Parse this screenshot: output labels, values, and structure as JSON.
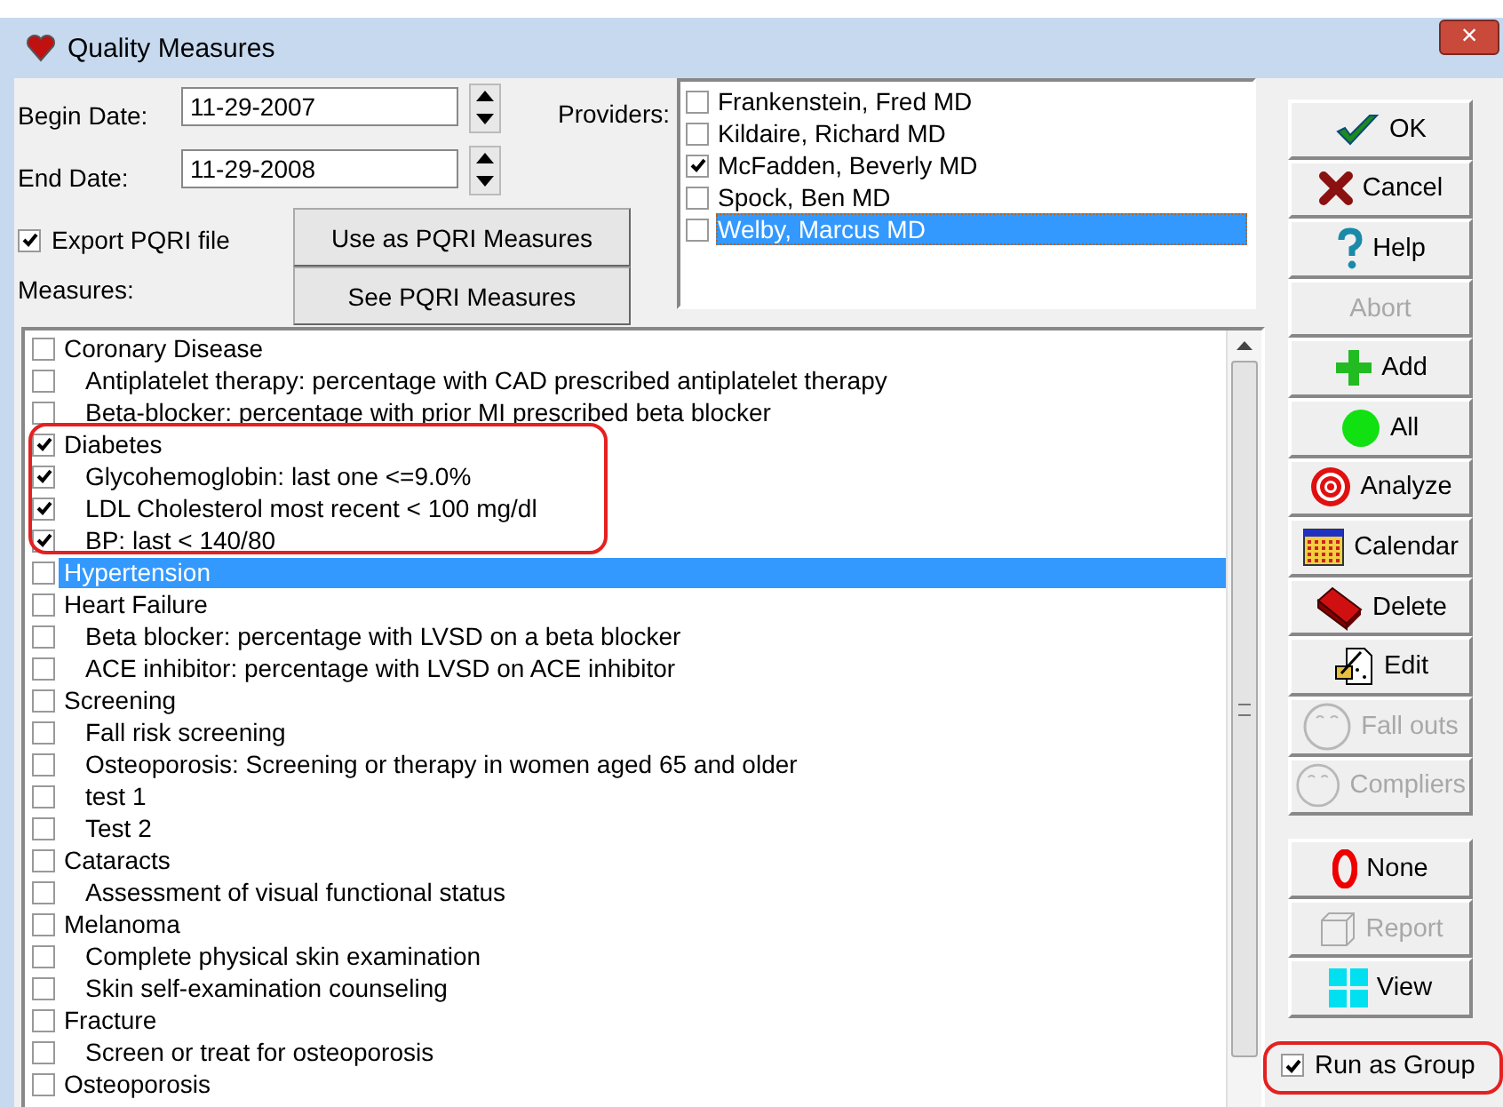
{
  "window": {
    "title": "Quality Measures",
    "close": "×"
  },
  "form": {
    "begin_label": "Begin Date:",
    "begin_value": "11-29-2007",
    "end_label": "End Date:",
    "end_value": "11-29-2008",
    "providers_label": "Providers:",
    "export_label": "Export PQRI file",
    "export_checked": true,
    "measures_label": "Measures:",
    "use_button": "Use as PQRI  Measures",
    "see_button": "See PQRI Measures"
  },
  "providers": [
    {
      "name": "Frankenstein, Fred MD",
      "checked": false,
      "selected": false
    },
    {
      "name": "Kildaire, Richard MD",
      "checked": false,
      "selected": false
    },
    {
      "name": "McFadden, Beverly MD",
      "checked": true,
      "selected": false
    },
    {
      "name": "Spock, Ben MD",
      "checked": false,
      "selected": false
    },
    {
      "name": "Welby, Marcus MD",
      "checked": false,
      "selected": true
    }
  ],
  "measures": [
    {
      "label": "Coronary Disease",
      "checked": false,
      "selected": false,
      "children": [
        {
          "label": "Antiplatelet therapy: percentage with CAD prescribed antiplatelet therapy",
          "checked": false,
          "selected": false
        },
        {
          "label": "Beta-blocker: percentage with prior MI prescribed beta blocker",
          "checked": false,
          "selected": false
        }
      ]
    },
    {
      "label": "Diabetes",
      "checked": true,
      "selected": false,
      "children": [
        {
          "label": "Glycohemoglobin: last one <=9.0%",
          "checked": true,
          "selected": false
        },
        {
          "label": "LDL Cholesterol most recent < 100 mg/dl",
          "checked": true,
          "selected": false
        },
        {
          "label": "BP: last < 140/80",
          "checked": true,
          "selected": false
        }
      ]
    },
    {
      "label": "Hypertension",
      "checked": false,
      "selected": true
    },
    {
      "label": "Heart Failure",
      "checked": false,
      "selected": false,
      "children": [
        {
          "label": "Beta blocker: percentage with LVSD on a beta blocker",
          "checked": false,
          "selected": false
        },
        {
          "label": "ACE inhibitor: percentage with LVSD on ACE inhibitor",
          "checked": false,
          "selected": false
        }
      ]
    },
    {
      "label": "Screening",
      "checked": false,
      "selected": false,
      "children": [
        {
          "label": "Fall risk screening",
          "checked": false,
          "selected": false
        },
        {
          "label": "Osteoporosis: Screening or therapy in women aged 65 and older",
          "checked": false,
          "selected": false
        },
        {
          "label": "test 1",
          "checked": false,
          "selected": false
        },
        {
          "label": "Test 2",
          "checked": false,
          "selected": false
        }
      ]
    },
    {
      "label": "Cataracts",
      "checked": false,
      "selected": false,
      "children": [
        {
          "label": "Assessment of visual functional status",
          "checked": false,
          "selected": false
        }
      ]
    },
    {
      "label": "Melanoma",
      "checked": false,
      "selected": false,
      "children": [
        {
          "label": "Complete physical skin examination",
          "checked": false,
          "selected": false
        },
        {
          "label": "Skin self-examination counseling",
          "checked": false,
          "selected": false
        }
      ]
    },
    {
      "label": "Fracture",
      "checked": false,
      "selected": false,
      "children": [
        {
          "label": "Screen or treat for osteoporosis",
          "checked": false,
          "selected": false
        }
      ]
    },
    {
      "label": "Osteoporosis",
      "checked": false,
      "selected": false
    }
  ],
  "buttons": [
    {
      "label": "OK",
      "kind": "ok",
      "disabled": false
    },
    {
      "label": "Cancel",
      "kind": "cancel",
      "disabled": false
    },
    {
      "label": "Help",
      "kind": "help",
      "disabled": false
    },
    {
      "label": "Abort",
      "kind": "none",
      "disabled": true
    },
    {
      "label": "Add",
      "kind": "add",
      "disabled": false
    },
    {
      "label": "All",
      "kind": "all",
      "disabled": false
    },
    {
      "label": "Analyze",
      "kind": "analyze",
      "disabled": false
    },
    {
      "label": "Calendar",
      "kind": "calendar",
      "disabled": false
    },
    {
      "label": "Delete",
      "kind": "delete",
      "disabled": false
    },
    {
      "label": "Edit",
      "kind": "edit",
      "disabled": false
    },
    {
      "label": "Fall outs",
      "kind": "face",
      "disabled": true
    },
    {
      "label": "Compliers",
      "kind": "face",
      "disabled": true
    }
  ],
  "buttons_lower": [
    {
      "label": "None",
      "kind": "zero",
      "disabled": false
    },
    {
      "label": "Report",
      "kind": "report",
      "disabled": true
    },
    {
      "label": "View",
      "kind": "view",
      "disabled": false
    }
  ],
  "run_as_group": {
    "label": "Run as Group",
    "checked": true
  }
}
